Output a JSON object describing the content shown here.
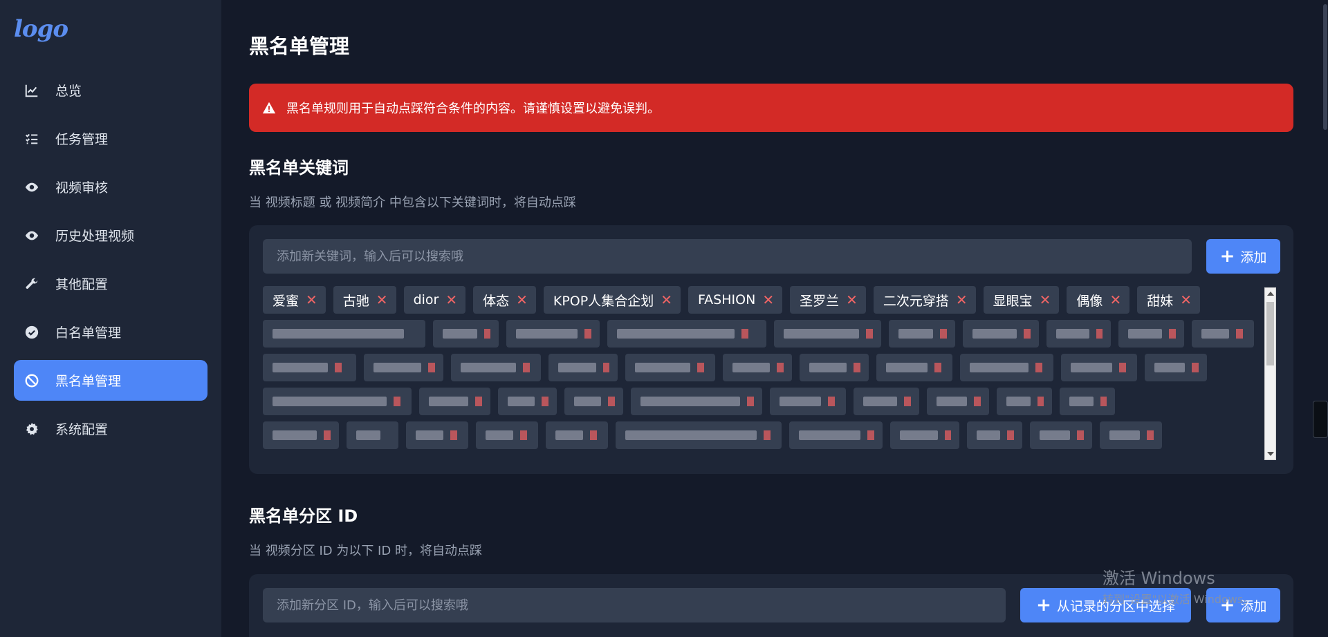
{
  "logo": "logo",
  "nav": [
    {
      "label": "总览",
      "icon": "chart-line-icon"
    },
    {
      "label": "任务管理",
      "icon": "task-list-icon"
    },
    {
      "label": "视频审核",
      "icon": "eye-icon"
    },
    {
      "label": "历史处理视频",
      "icon": "eye-icon"
    },
    {
      "label": "其他配置",
      "icon": "wrench-icon"
    },
    {
      "label": "白名单管理",
      "icon": "check-circle-icon"
    },
    {
      "label": "黑名单管理",
      "icon": "ban-icon",
      "active": true
    },
    {
      "label": "系统配置",
      "icon": "gear-icon"
    }
  ],
  "page_title": "黑名单管理",
  "alert": {
    "text": "黑名单规则用于自动点踩符合条件的内容。请谨慎设置以避免误判。",
    "color": "#d32a26"
  },
  "keywords": {
    "title": "黑名单关键词",
    "desc": "当 视频标题 或 视频简介 中包含以下关键词时，将自动点踩",
    "placeholder": "添加新关键词，输入后可以搜索哦",
    "add_label": "添加",
    "visible_tags": [
      "爱蜜",
      "古驰",
      "dior",
      "体态",
      "KPOP人集合企划",
      "FASHION",
      "圣罗兰",
      "二次元穿搭",
      "显眼宝",
      "偶像",
      "甜妹"
    ]
  },
  "partition": {
    "title": "黑名单分区 ID",
    "desc": "当 视频分区 ID 为以下 ID 时，将自动点踩",
    "placeholder": "添加新分区 ID，输入后可以搜索哦",
    "select_label": "从记录的分区中选择",
    "add_label": "添加"
  },
  "watermark": {
    "line1": "激活 Windows",
    "line2": "转到\"设置\"以激活 Windows。"
  },
  "accent_color": "#4e86f7"
}
